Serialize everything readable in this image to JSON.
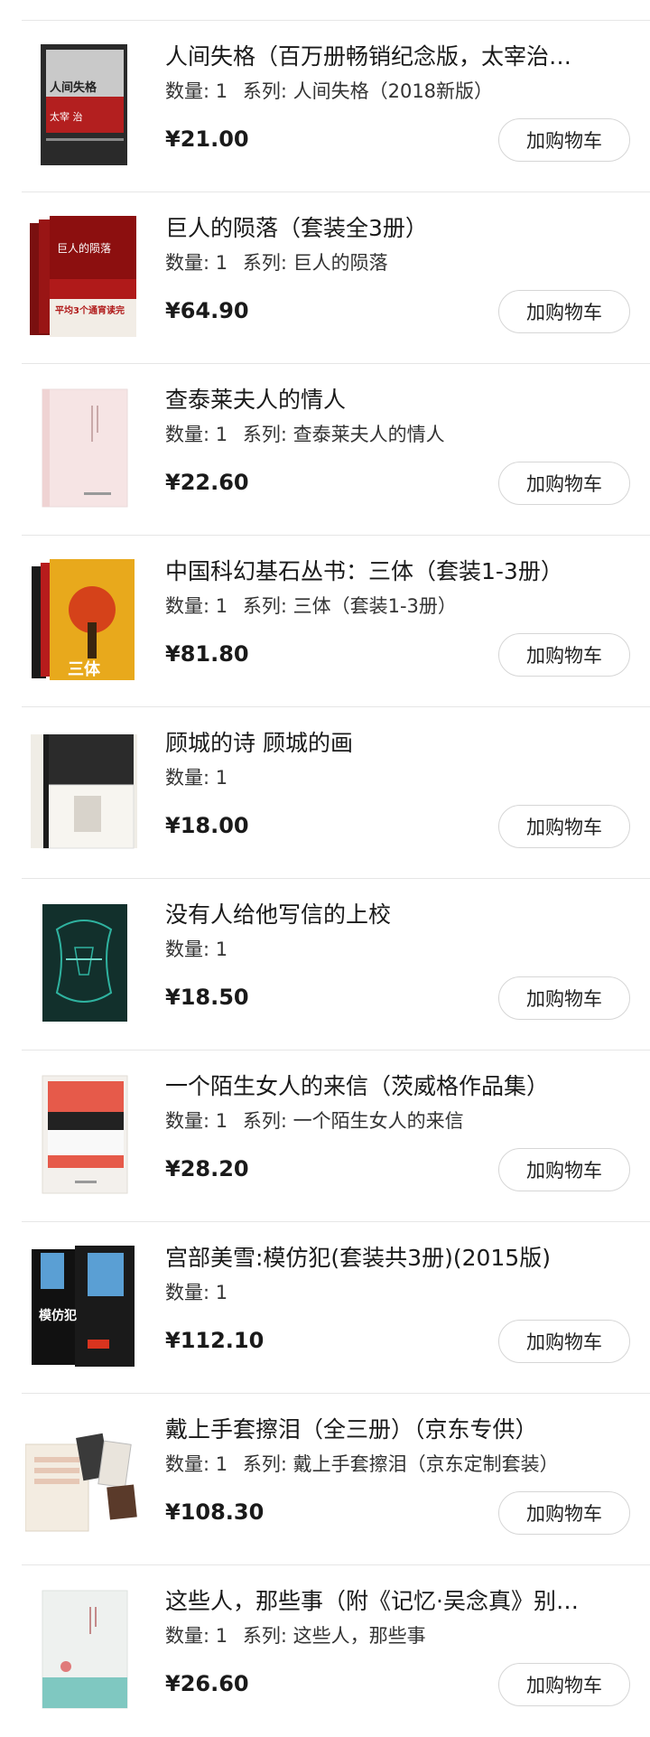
{
  "labels": {
    "quantity": "数量:",
    "series": "系列:",
    "add_to_cart": "加购物车"
  },
  "items": [
    {
      "title": "人间失格（百万册畅销纪念版，太宰治…",
      "qty": "1",
      "series": "人间失格（2018新版）",
      "price": "¥21.00",
      "cover": {
        "text": "人间失格",
        "subtitle": "太宰 治"
      }
    },
    {
      "title": "巨人的陨落（套装全3册）",
      "qty": "1",
      "series": "巨人的陨落",
      "price": "¥64.90",
      "cover": {
        "text": "巨人的陨落",
        "subtitle": "平均3个通宵读完"
      }
    },
    {
      "title": "查泰莱夫人的情人",
      "qty": "1",
      "series": "查泰莱夫人的情人",
      "price": "¥22.60",
      "cover": {
        "text": "",
        "subtitle": ""
      }
    },
    {
      "title": "中国科幻基石丛书：三体（套装1-3册）",
      "qty": "1",
      "series": "三体（套装1-3册）",
      "price": "¥81.80",
      "cover": {
        "text": "三体",
        "subtitle": ""
      }
    },
    {
      "title": "顾城的诗 顾城的画",
      "qty": "1",
      "series": "",
      "price": "¥18.00",
      "cover": {
        "text": "",
        "subtitle": ""
      }
    },
    {
      "title": "没有人给他写信的上校",
      "qty": "1",
      "series": "",
      "price": "¥18.50",
      "cover": {
        "text": "",
        "subtitle": ""
      }
    },
    {
      "title": "一个陌生女人的来信（茨威格作品集）",
      "qty": "1",
      "series": "一个陌生女人的来信",
      "price": "¥28.20",
      "cover": {
        "text": "",
        "subtitle": ""
      }
    },
    {
      "title": "宫部美雪:模仿犯(套装共3册)(2015版)",
      "qty": "1",
      "series": "",
      "price": "¥112.10",
      "cover": {
        "text": "模仿犯",
        "subtitle": ""
      }
    },
    {
      "title": "戴上手套擦泪（全三册）（京东专供）",
      "qty": "1",
      "series": "戴上手套擦泪（京东定制套装）",
      "price": "¥108.30",
      "cover": {
        "text": "",
        "subtitle": ""
      }
    },
    {
      "title": "这些人，那些事（附《记忆·吴念真》别…",
      "qty": "1",
      "series": "这些人，那些事",
      "price": "¥26.60",
      "cover": {
        "text": "",
        "subtitle": ""
      }
    }
  ]
}
